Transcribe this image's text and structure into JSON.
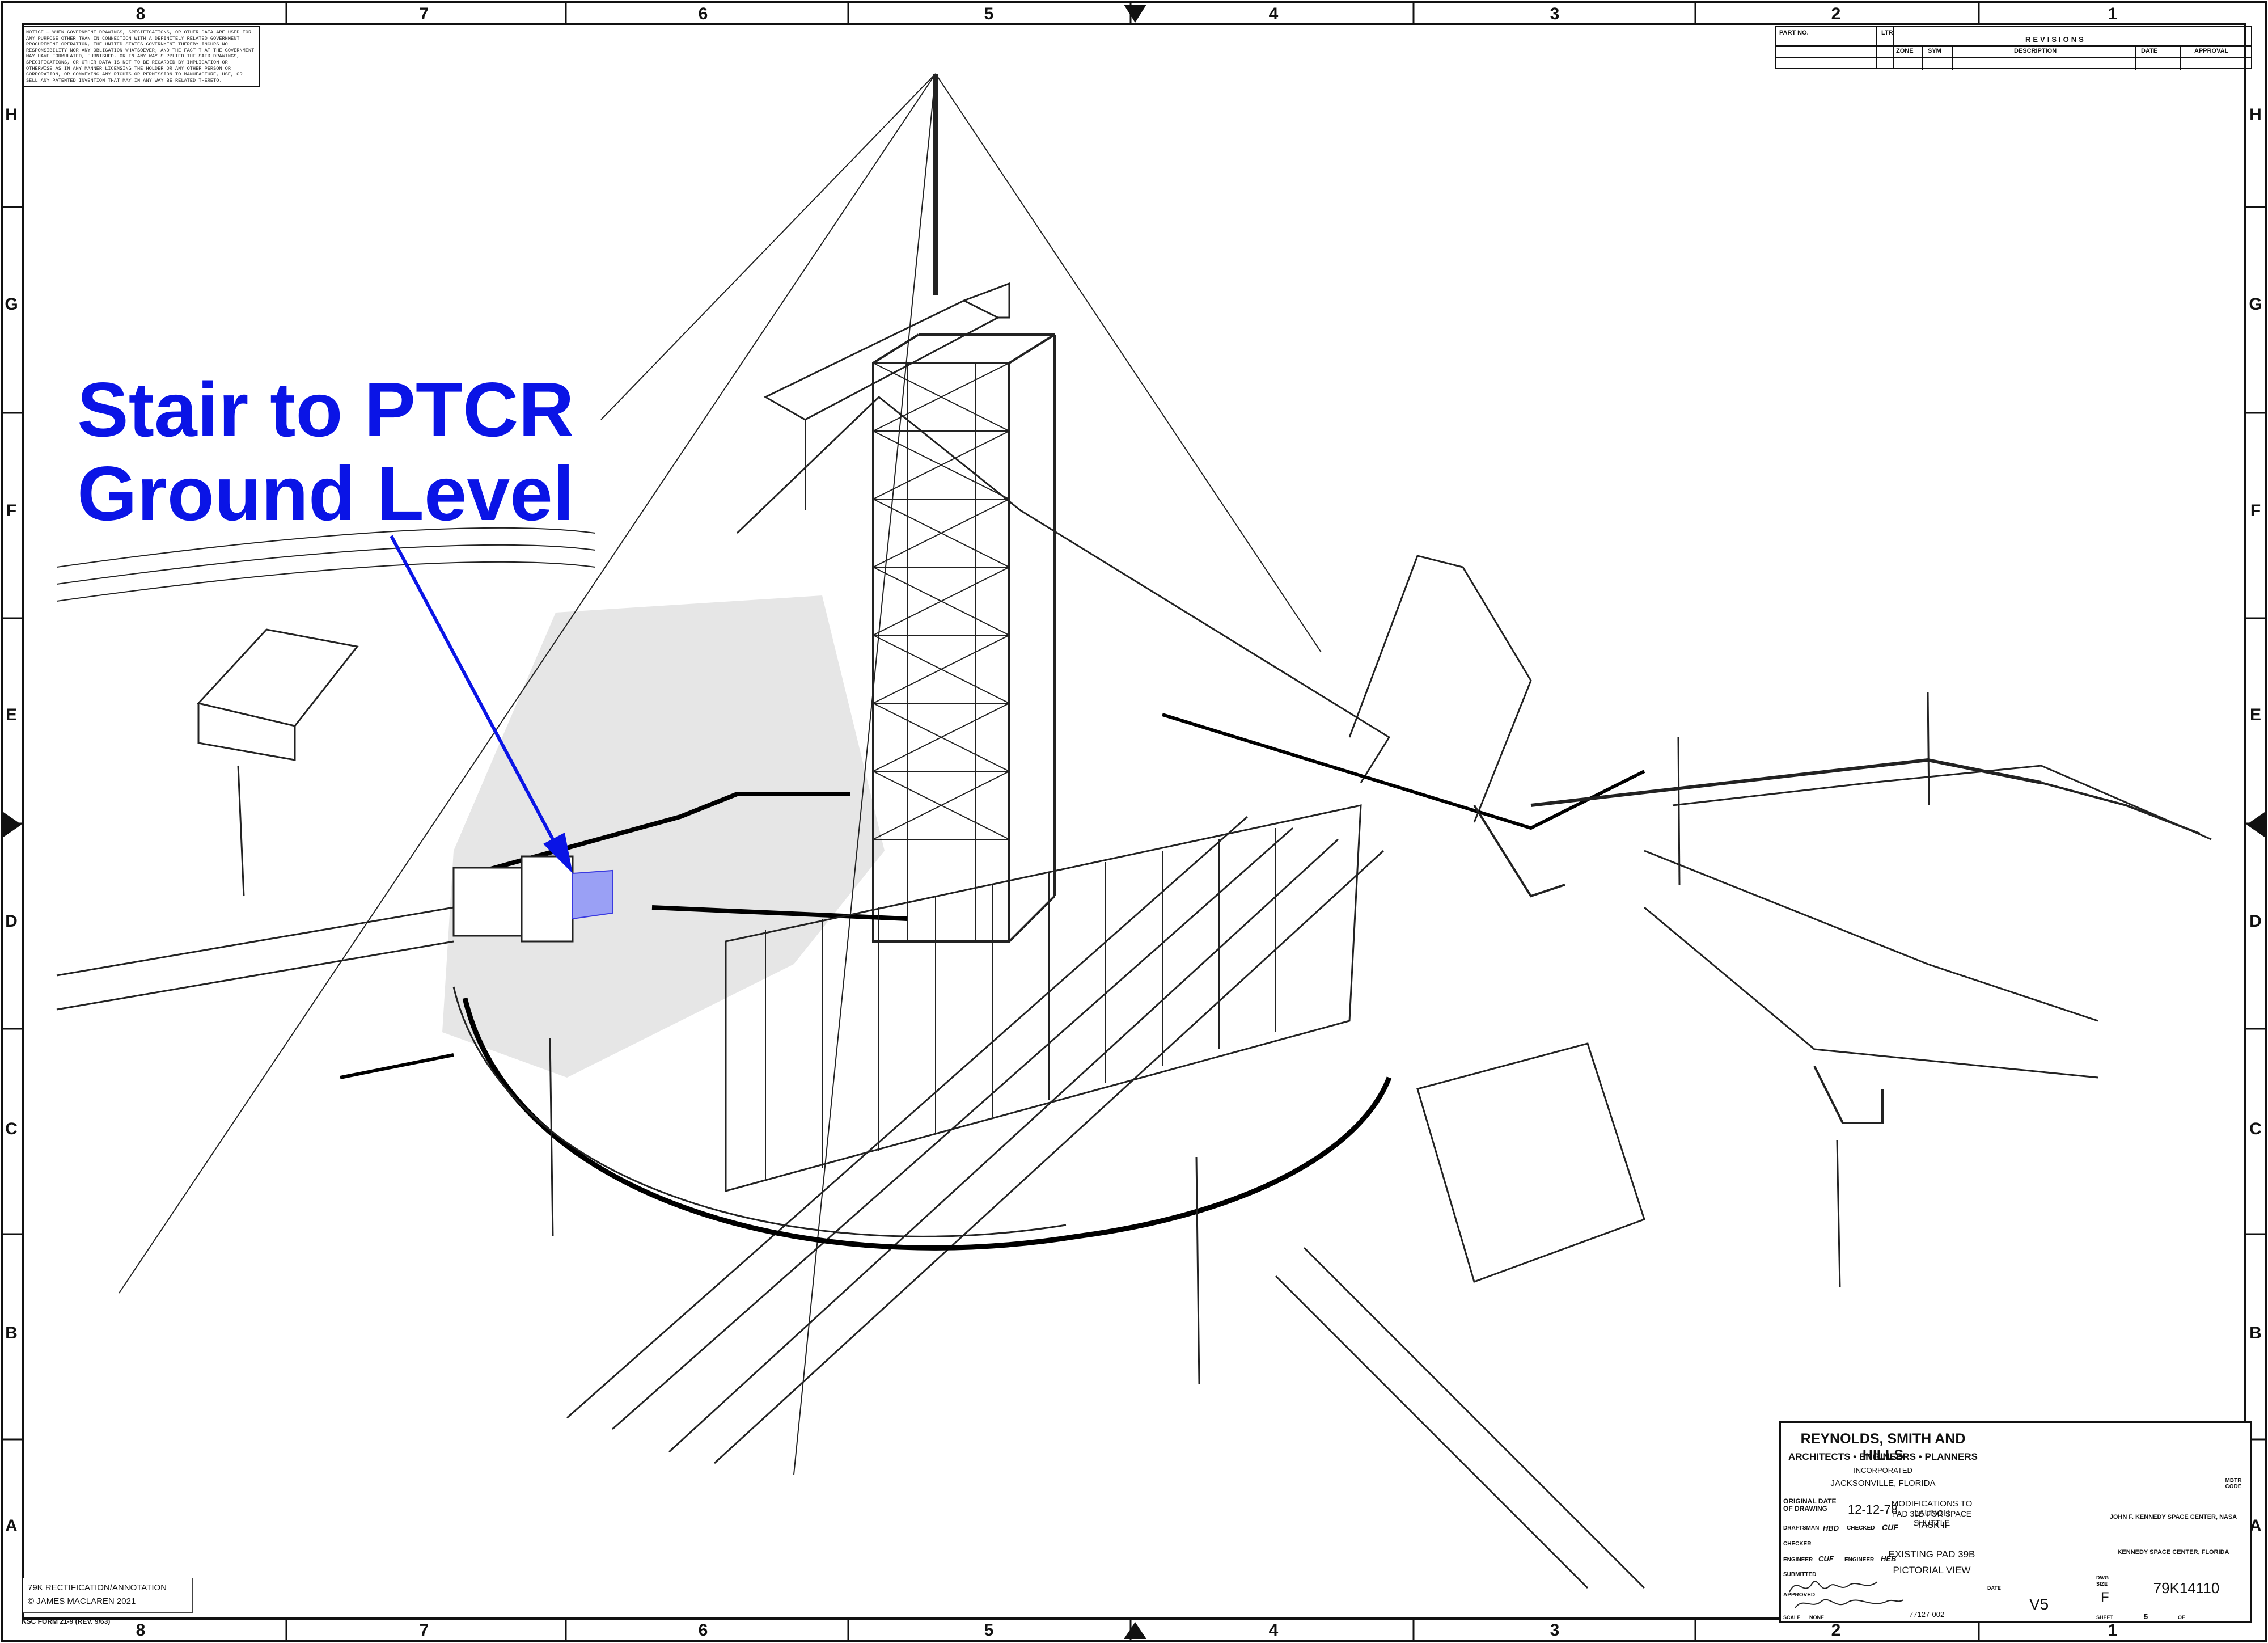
{
  "grid": {
    "columns": [
      "8",
      "7",
      "6",
      "5",
      "4",
      "3",
      "2",
      "1"
    ],
    "rows": [
      "H",
      "G",
      "F",
      "E",
      "D",
      "C",
      "B",
      "A"
    ]
  },
  "notice": "NOTICE — WHEN GOVERNMENT DRAWINGS, SPECIFICATIONS, OR OTHER DATA ARE USED FOR ANY PURPOSE OTHER THAN IN CONNECTION WITH A DEFINITELY RELATED GOVERNMENT PROCUREMENT OPERATION, THE UNITED STATES GOVERNMENT THEREBY INCURS NO RESPONSIBILITY NOR ANY OBLIGATION WHATSOEVER; AND THE FACT THAT THE GOVERNMENT MAY HAVE FORMULATED, FURNISHED, OR IN ANY WAY SUPPLIED THE SAID DRAWINGS, SPECIFICATIONS, OR OTHER DATA IS NOT TO BE REGARDED BY IMPLICATION OR OTHERWISE AS IN ANY MANNER LICENSING THE HOLDER OR ANY OTHER PERSON OR CORPORATION, OR CONVEYING ANY RIGHTS OR PERMISSION TO MANUFACTURE, USE, OR SELL ANY PATENTED INVENTION THAT MAY IN ANY WAY BE RELATED THERETO.",
  "revisions": {
    "part_no": "PART NO.",
    "ltr": "LTR",
    "title": "REVISIONS",
    "zone": "ZONE",
    "sym": "SYM",
    "description": "DESCRIPTION",
    "date": "DATE",
    "approval": "APPROVAL"
  },
  "annotation": {
    "line1": "Stair to PTCR",
    "line2": "Ground Level",
    "color": "#0a14e6"
  },
  "title_block": {
    "firm": "REYNOLDS, SMITH AND HILLS",
    "firm_sub": "ARCHITECTS • ENGINEERS • PLANNERS",
    "incorporated": "INCORPORATED",
    "city": "JACKSONVILLE, FLORIDA",
    "original_date_label": "ORIGINAL DATE OF DRAWING",
    "original_date": "12-12-78",
    "draftsman_label": "DRAFTSMAN",
    "draftsman": "HBD",
    "checked_label": "CHECKED",
    "checked": "CUF",
    "checker_label": "CHECKER",
    "engineer_label": "ENGINEER",
    "engineer": "CUF",
    "engineer2_label": "ENGINEER",
    "engineer2": "HEB",
    "submitted_label": "SUBMITTED",
    "approved_label": "APPROVED",
    "project_line1": "MODIFICATIONS TO LAUNCH",
    "project_line2": "PAD 39B FOR SPACE SHUTTLE",
    "task": "-TASK II-",
    "drawing_title1": "EXISTING PAD 39B",
    "drawing_title2": "PICTORIAL VIEW",
    "agency1": "JOHN F. KENNEDY SPACE CENTER, NASA",
    "agency2": "KENNEDY SPACE CENTER, FLORIDA",
    "mbtr_code_label": "MBTR CODE",
    "dwg_size_label": "DWG SIZE",
    "dwg_size": "F",
    "dwg_no": "79K14110",
    "date_label": "DATE",
    "scale_label": "SCALE",
    "scale": "NONE",
    "job_no": "77127-002",
    "sheet_code": "V5",
    "sheet_label": "SHEET",
    "sheet": "5",
    "of_label": "OF"
  },
  "credit": {
    "line1": "79K RECTIFICATION/ANNOTATION",
    "line2": "© JAMES MACLAREN 2021"
  },
  "form_no": "KSC FORM 21-9 (REV. 9/63)"
}
